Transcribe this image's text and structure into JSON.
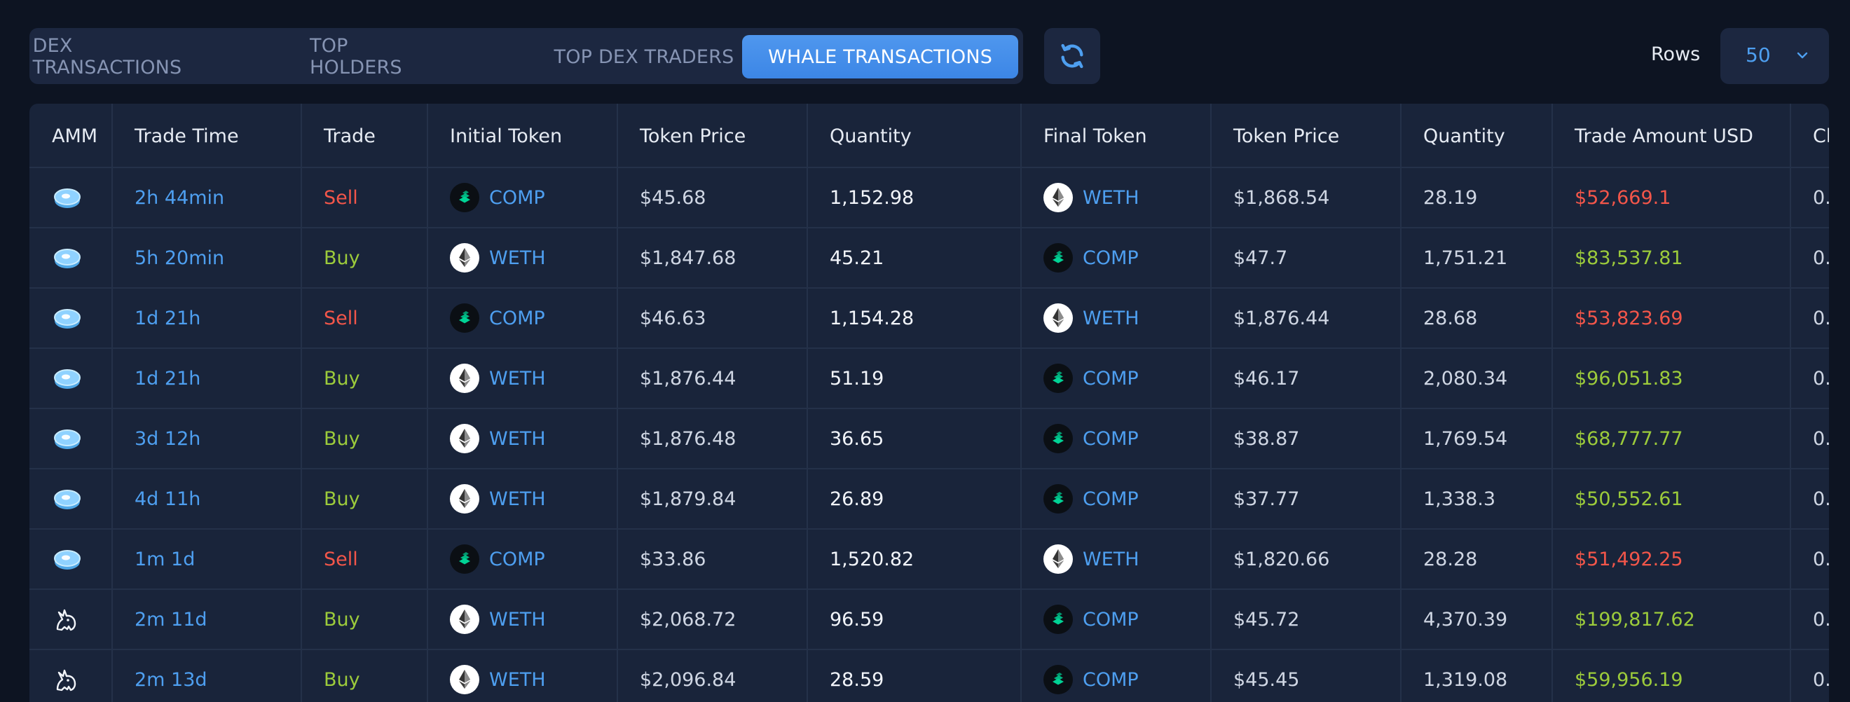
{
  "tabs": [
    {
      "label": "DEX TRANSACTIONS",
      "active": false
    },
    {
      "label": "TOP HOLDERS",
      "active": false
    },
    {
      "label": "TOP DEX TRADERS",
      "active": false
    },
    {
      "label": "WHALE TRANSACTIONS",
      "active": true
    }
  ],
  "refresh": {
    "icon": "refresh-icon"
  },
  "rows_control": {
    "label": "Rows",
    "value": "50",
    "icon": "chevron-down-icon"
  },
  "table": {
    "headers": [
      "AMM",
      "Trade Time",
      "Trade",
      "Initial Token",
      "Token Price",
      "Quantity",
      "Final Token",
      "Token Price",
      "Quantity",
      "Trade Amount USD",
      "Ch"
    ],
    "rows": [
      {
        "amm": "amm-disc-icon",
        "time": "2h 44min",
        "trade": "Sell",
        "init_token": "COMP",
        "init_price": "$45.68",
        "init_qty": "1,152.98",
        "final_token": "WETH",
        "final_price": "$1,868.54",
        "final_qty": "28.19",
        "amount": "$52,669.1",
        "ch": "0."
      },
      {
        "amm": "amm-disc-icon",
        "time": "5h 20min",
        "trade": "Buy",
        "init_token": "WETH",
        "init_price": "$1,847.68",
        "init_qty": "45.21",
        "final_token": "COMP",
        "final_price": "$47.7",
        "final_qty": "1,751.21",
        "amount": "$83,537.81",
        "ch": "0."
      },
      {
        "amm": "amm-disc-icon",
        "time": "1d 21h",
        "trade": "Sell",
        "init_token": "COMP",
        "init_price": "$46.63",
        "init_qty": "1,154.28",
        "final_token": "WETH",
        "final_price": "$1,876.44",
        "final_qty": "28.68",
        "amount": "$53,823.69",
        "ch": "0."
      },
      {
        "amm": "amm-disc-icon",
        "time": "1d 21h",
        "trade": "Buy",
        "init_token": "WETH",
        "init_price": "$1,876.44",
        "init_qty": "51.19",
        "final_token": "COMP",
        "final_price": "$46.17",
        "final_qty": "2,080.34",
        "amount": "$96,051.83",
        "ch": "0."
      },
      {
        "amm": "amm-disc-icon",
        "time": "3d 12h",
        "trade": "Buy",
        "init_token": "WETH",
        "init_price": "$1,876.48",
        "init_qty": "36.65",
        "final_token": "COMP",
        "final_price": "$38.87",
        "final_qty": "1,769.54",
        "amount": "$68,777.77",
        "ch": "0."
      },
      {
        "amm": "amm-disc-icon",
        "time": "4d 11h",
        "trade": "Buy",
        "init_token": "WETH",
        "init_price": "$1,879.84",
        "init_qty": "26.89",
        "final_token": "COMP",
        "final_price": "$37.77",
        "final_qty": "1,338.3",
        "amount": "$50,552.61",
        "ch": "0."
      },
      {
        "amm": "amm-disc-icon",
        "time": "1m 1d",
        "trade": "Sell",
        "init_token": "COMP",
        "init_price": "$33.86",
        "init_qty": "1,520.82",
        "final_token": "WETH",
        "final_price": "$1,820.66",
        "final_qty": "28.28",
        "amount": "$51,492.25",
        "ch": "0."
      },
      {
        "amm": "amm-unicorn-icon",
        "time": "2m 11d",
        "trade": "Buy",
        "init_token": "WETH",
        "init_price": "$2,068.72",
        "init_qty": "96.59",
        "final_token": "COMP",
        "final_price": "$45.72",
        "final_qty": "4,370.39",
        "amount": "$199,817.62",
        "ch": "0."
      },
      {
        "amm": "amm-unicorn-icon",
        "time": "2m 13d",
        "trade": "Buy",
        "init_token": "WETH",
        "init_price": "$2,096.84",
        "init_qty": "28.59",
        "final_token": "COMP",
        "final_price": "$45.45",
        "final_qty": "1,319.08",
        "amount": "$59,956.19",
        "ch": "0."
      }
    ]
  },
  "colors": {
    "background": "#0d1422",
    "panel": "#1c2740",
    "accent": "#4e9ff0",
    "sell": "#f3564a",
    "buy": "#9ccb3b"
  }
}
